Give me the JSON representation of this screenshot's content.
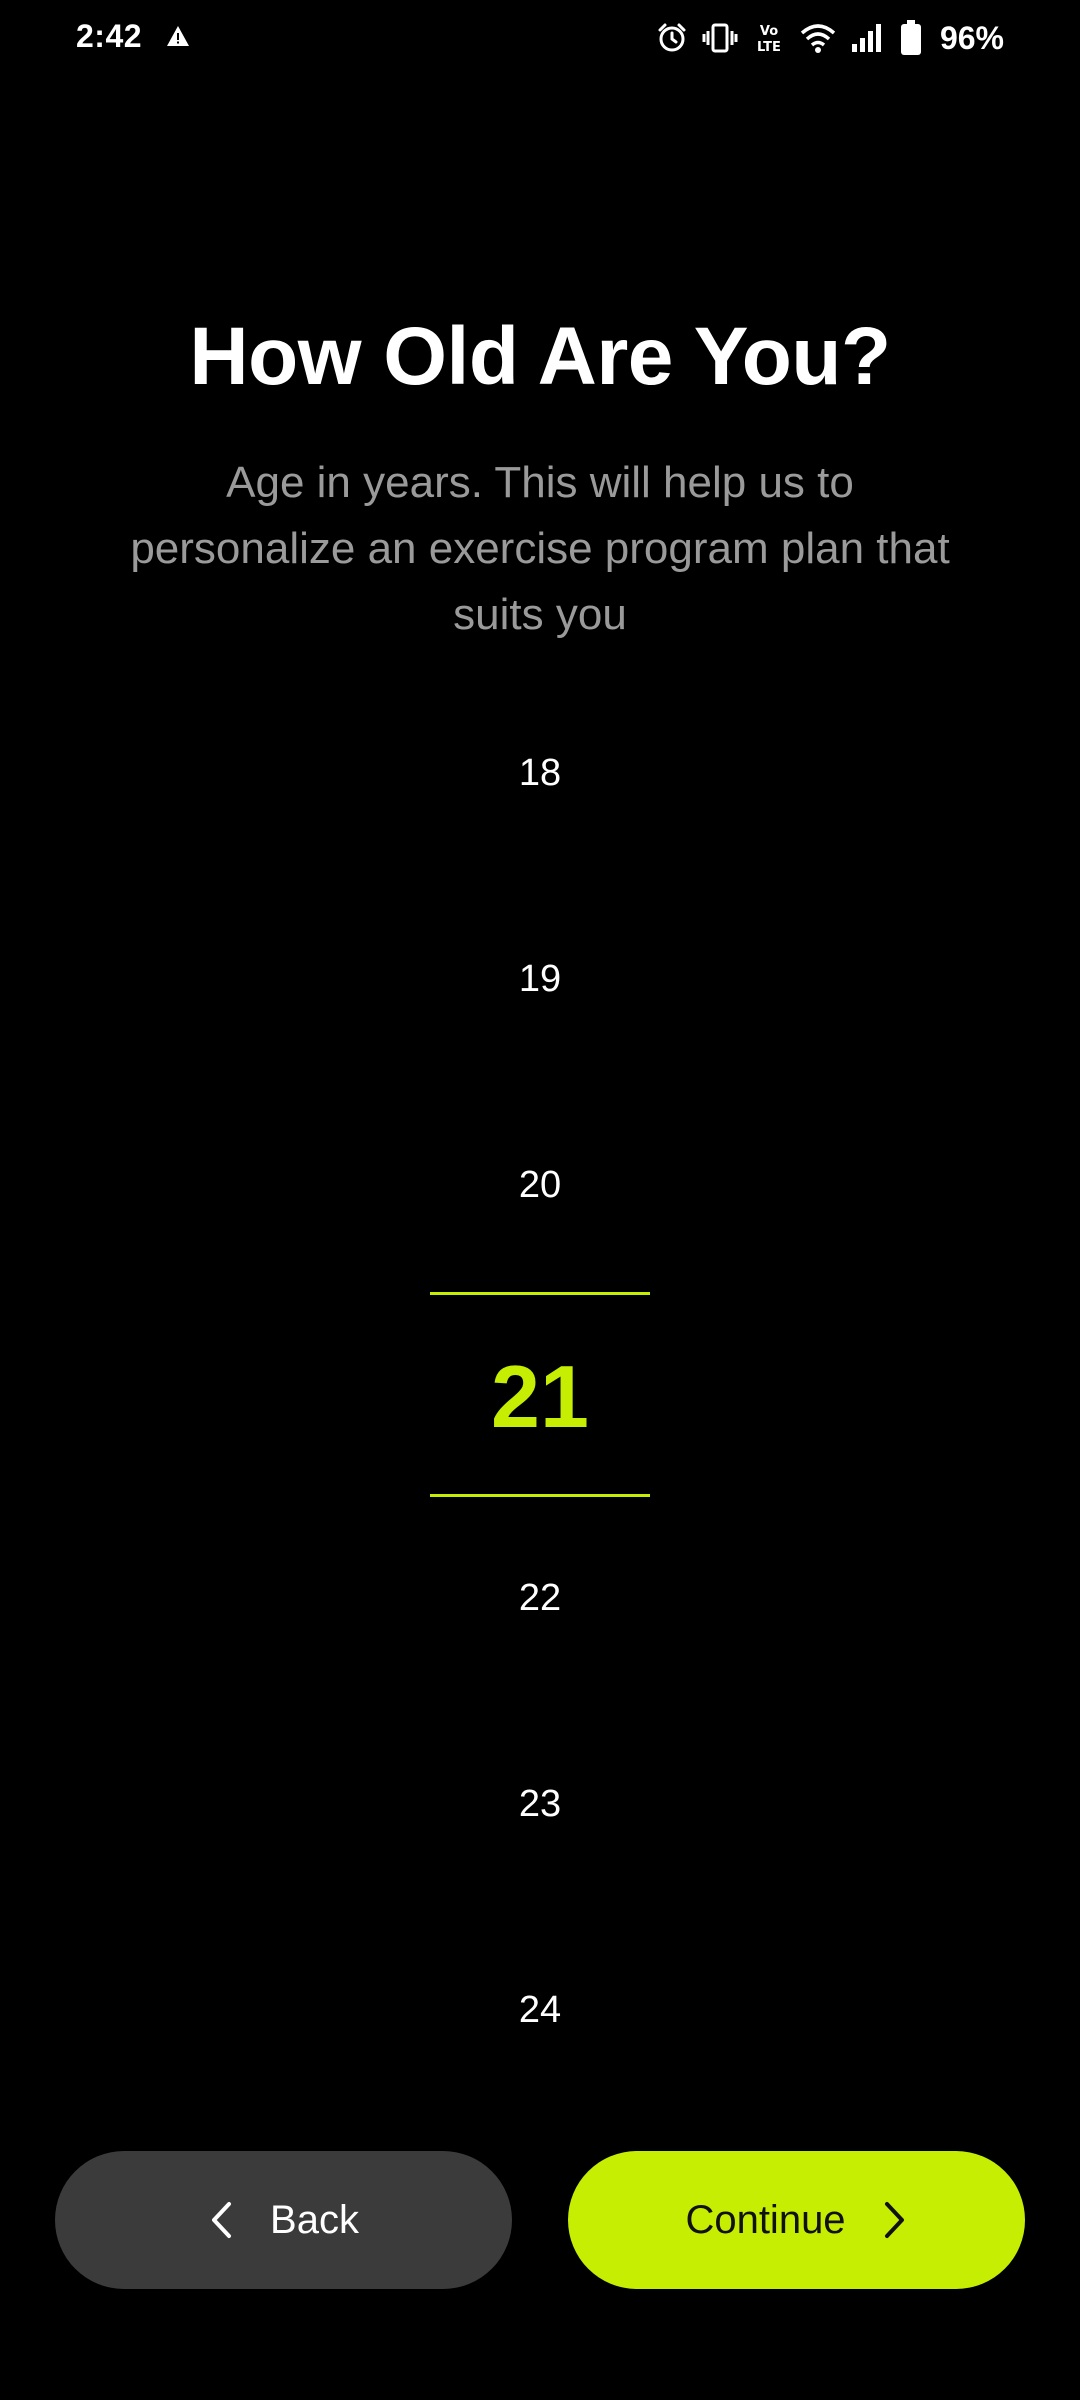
{
  "status_bar": {
    "time": "2:42",
    "battery": "96%",
    "icons": [
      "warning-icon",
      "alarm-icon",
      "vibrate-icon",
      "volte-icon",
      "wifi-icon",
      "signal-icon",
      "battery-icon"
    ]
  },
  "header": {
    "title": "How Old Are You?",
    "subtitle": "Age in years. This will help us to personalize an exercise program plan that suits you"
  },
  "picker": {
    "items": [
      "18",
      "19",
      "20",
      "21",
      "22",
      "23",
      "24"
    ],
    "selected": "21"
  },
  "buttons": {
    "back_label": "Back",
    "continue_label": "Continue"
  },
  "colors": {
    "accent": "#c6ee02",
    "background": "#000000",
    "back_button": "#3b3b3b",
    "subtitle": "#9a9a9a"
  }
}
